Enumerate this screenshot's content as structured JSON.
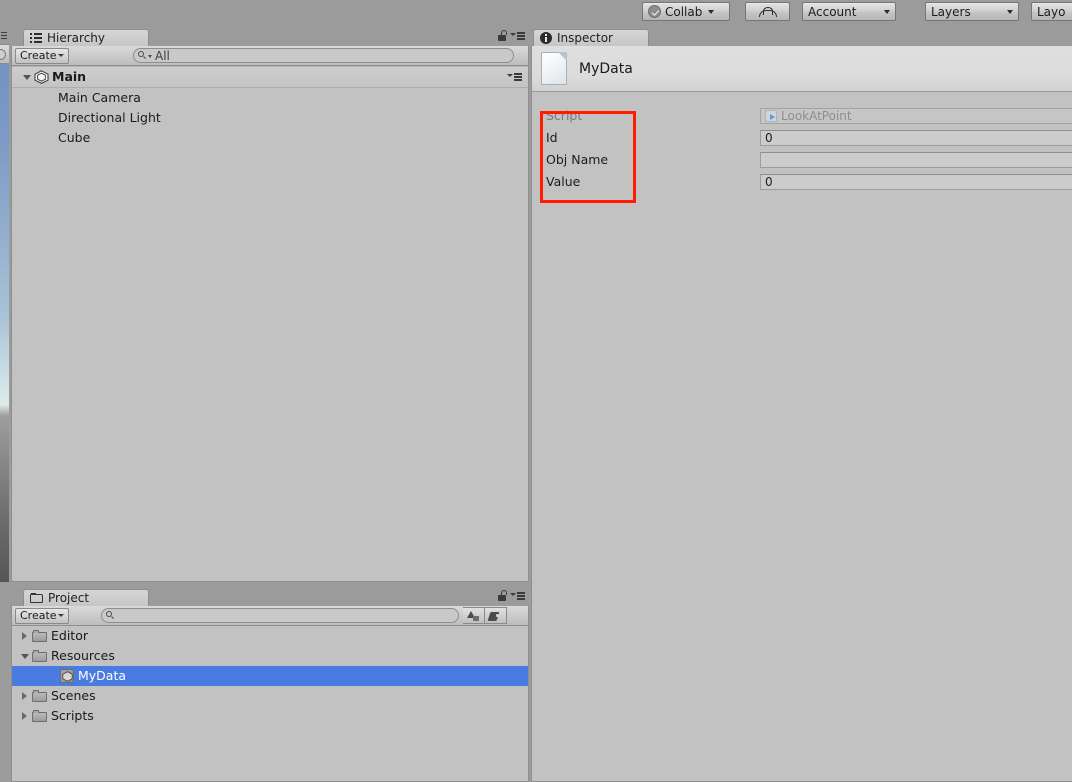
{
  "toolbar": {
    "collab_label": "Collab",
    "collab_icon": "checkmark-circle-icon",
    "cloud_icon": "cloud-icon",
    "account_label": "Account",
    "layers_label": "Layers",
    "layout_label": "Layo"
  },
  "hierarchy": {
    "tab_label": "Hierarchy",
    "tab_icon": "hierarchy-list-icon",
    "lock_icon": "lock-open-icon",
    "menu_icon": "panel-menu-icon",
    "create_label": "Create",
    "search_value": "All",
    "search_icon": "search-icon",
    "rows": [
      {
        "label": "Main",
        "indent": 0,
        "twisty": "down",
        "icon": "unity-scene-icon",
        "bold": true,
        "type": "scene"
      },
      {
        "label": "Main Camera",
        "indent": 1,
        "twisty": "none",
        "icon": "",
        "bold": false,
        "type": "object"
      },
      {
        "label": "Directional Light",
        "indent": 1,
        "twisty": "none",
        "icon": "",
        "bold": false,
        "type": "object"
      },
      {
        "label": "Cube",
        "indent": 1,
        "twisty": "none",
        "icon": "",
        "bold": false,
        "type": "object"
      }
    ]
  },
  "project": {
    "tab_label": "Project",
    "tab_icon": "folder-icon",
    "lock_icon": "lock-open-icon",
    "menu_icon": "panel-menu-icon",
    "create_label": "Create",
    "search_value": "",
    "search_icon": "search-icon",
    "filter_type_icon": "shapes-filter-icon",
    "filter_label_icon": "tag-label-icon",
    "rows": [
      {
        "label": "Editor",
        "indent": 0,
        "twisty": "right",
        "icon": "folder-icon",
        "selected": false
      },
      {
        "label": "Resources",
        "indent": 0,
        "twisty": "down",
        "icon": "folder-icon",
        "selected": false
      },
      {
        "label": "MyData",
        "indent": 1,
        "twisty": "none",
        "icon": "scriptable-object-icon",
        "selected": true
      },
      {
        "label": "Scenes",
        "indent": 0,
        "twisty": "right",
        "icon": "folder-icon",
        "selected": false
      },
      {
        "label": "Scripts",
        "indent": 0,
        "twisty": "right",
        "icon": "folder-icon",
        "selected": false
      }
    ]
  },
  "inspector": {
    "tab_label": "Inspector",
    "tab_icon": "info-icon",
    "asset_icon": "asset-page-icon",
    "asset_name": "MyData",
    "properties": [
      {
        "label": "Script",
        "value": "LookAtPoint",
        "kind": "object",
        "disabled": true,
        "icon": "script-asset-icon"
      },
      {
        "label": "Id",
        "value": "0",
        "kind": "number",
        "disabled": false,
        "icon": ""
      },
      {
        "label": "Obj Name",
        "value": "",
        "kind": "text",
        "disabled": false,
        "icon": ""
      },
      {
        "label": "Value",
        "value": "0",
        "kind": "number",
        "disabled": false,
        "icon": ""
      }
    ]
  },
  "annotation": {
    "color": "#ff1a00",
    "target": "property-label-column"
  },
  "colors": {
    "panel_bg": "#c2c2c2",
    "chrome_bg": "#9b9b9b",
    "selection_blue": "#4a7be0",
    "annotation_red": "#ff1a00",
    "disabled_text": "#7a7a7a"
  }
}
